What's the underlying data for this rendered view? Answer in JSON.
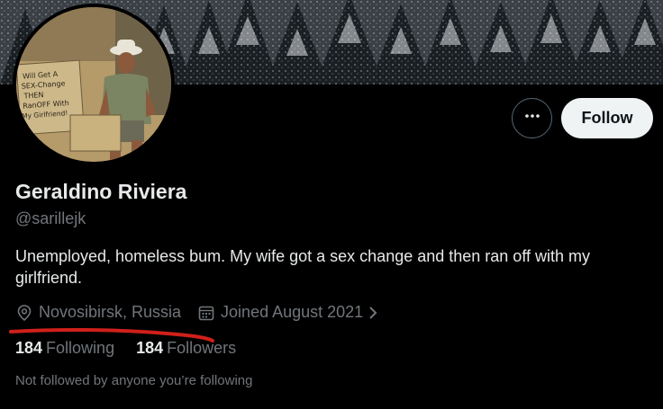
{
  "profile": {
    "display_name": "Geraldino Riviera",
    "handle": "@sarillejk",
    "bio": "Unemployed, homeless bum. My wife got a sex change and then ran off with my girlfriend.",
    "location": "Novosibirsk, Russia",
    "joined": "Joined August 2021",
    "following_count": "184",
    "following_label": "Following",
    "followers_count": "184",
    "followers_label": "Followers",
    "not_followed_note": "Not followed by anyone you’re following"
  },
  "avatar": {
    "sign_text": [
      "Will Get A",
      "SEX-Change",
      "THEN",
      "RanOFF With",
      "My Girlfriend!"
    ]
  },
  "actions": {
    "follow_label": "Follow",
    "more_icon": "more-dots-icon"
  },
  "icons": {
    "location": "map-pin-icon",
    "calendar": "calendar-icon",
    "chevron": "chevron-right-icon"
  },
  "colors": {
    "background": "#000000",
    "primary_text": "#e7e9ea",
    "secondary_text": "#71767b",
    "follow_button_bg": "#eff3f4",
    "annotation_red": "#d0201a"
  }
}
